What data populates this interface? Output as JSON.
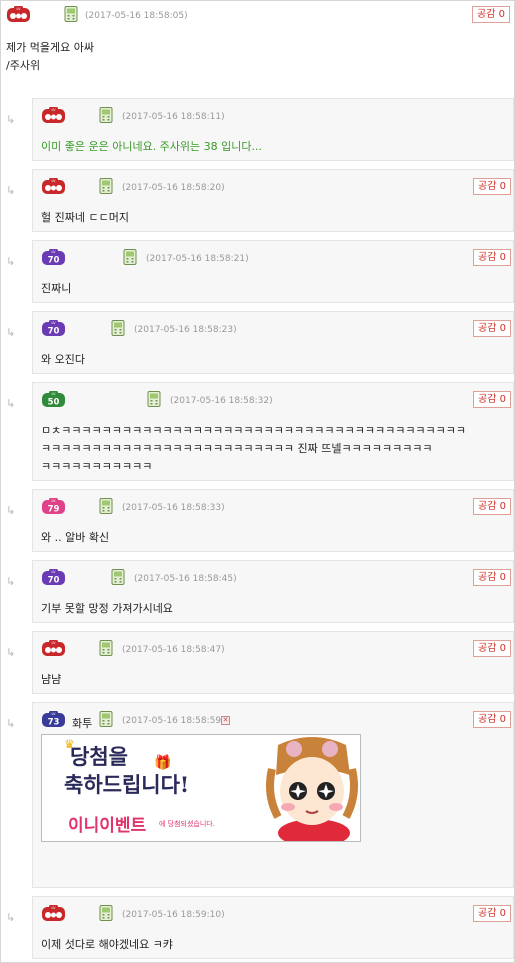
{
  "main_post": {
    "timestamp": "(2017-05-16 18:58:05)",
    "like_label": "공감 0",
    "text": "제가 먹을게요 아싸\n/주사위"
  },
  "replies": [
    {
      "level": "",
      "badge_color": "#c8282a",
      "timestamp": "(2017-05-16 18:58:11)",
      "text": "이미 좋은 운은 아니네요. 주사위는 38 입니다...",
      "like_label": ""
    },
    {
      "level": "",
      "badge_color": "#c8282a",
      "timestamp": "(2017-05-16 18:58:20)",
      "text": "헐 진짜네 ㄷㄷ머지",
      "like_label": "공감 0"
    },
    {
      "level": "70",
      "badge_color": "#6a3bb5",
      "timestamp": "(2017-05-16 18:58:21)",
      "text": "진짜니",
      "like_label": "공감 0"
    },
    {
      "level": "70",
      "badge_color": "#6a3bb5",
      "timestamp": "(2017-05-16 18:58:23)",
      "text": "와 오진다",
      "like_label": "공감 0"
    },
    {
      "level": "50",
      "badge_color": "#2f8a3a",
      "timestamp": "(2017-05-16 18:58:32)",
      "text": "ㅁㅊㅋㅋㅋㅋㅋㅋㅋㅋㅋㅋㅋㅋㅋㅋㅋㅋㅋㅋㅋㅋㅋㅋㅋㅋㅋㅋㅋㅋㅋㅋㅋㅋㅋㅋㅋㅋㅋㅋㅋㅋ\nㅋㅋㅋㅋㅋㅋㅋㅋㅋㅋㅋㅋㅋㅋㅋㅋㅋㅋㅋㅋㅋㅋㅋㅋㅋ 진짜 뜨넬ㅋㅋㅋㅋㅋㅋㅋㅋㅋ\nㅋㅋㅋㅋㅋㅋㅋㅋㅋㅋㅋ",
      "like_label": "공감 0"
    },
    {
      "level": "79",
      "badge_color": "#e0428a",
      "timestamp": "(2017-05-16 18:58:33)",
      "text": "와 .. 알바 확신",
      "like_label": "공감 0"
    },
    {
      "level": "70",
      "badge_color": "#6a3bb5",
      "timestamp": "(2017-05-16 18:58:45)",
      "text": "기부 못할 망정 가져가시네요",
      "like_label": "공감 0"
    },
    {
      "level": "",
      "badge_color": "#c8282a",
      "timestamp": "(2017-05-16 18:58:47)",
      "text": "냠냠",
      "like_label": "공감 0"
    },
    {
      "level": "73",
      "badge_color": "#3a3a9a",
      "nickname": "화투",
      "timestamp": "(2017-05-16 18:58:59)",
      "text": "",
      "like_label": "공감 0",
      "banner": {
        "line1": "당첨을",
        "line2": "축하드립니다!",
        "event_name": "이니이벤트",
        "event_suffix": "에 당첨되셨습니다."
      }
    },
    {
      "level": "",
      "badge_color": "#c8282a",
      "timestamp": "(2017-05-16 18:59:10)",
      "text": "이제 섯다로 해야겠네요 ㅋ캬",
      "like_label": "공감 0"
    }
  ],
  "icons": {
    "mobile": "mobile-phone-icon",
    "reply": "reply-arrow-icon",
    "broken_image": "broken-image-icon",
    "level_badge": "level-badge-icon"
  },
  "colors": {
    "like_text": "#d2322d",
    "dice_text": "#3a9a2a",
    "timestamp": "#999999"
  }
}
